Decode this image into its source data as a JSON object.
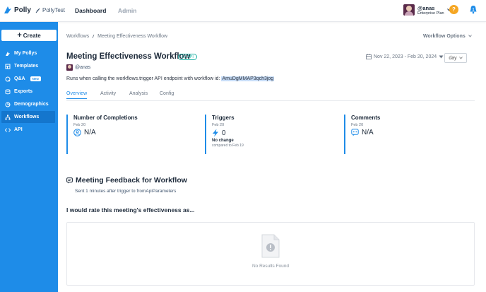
{
  "topbar": {
    "brand": "Polly",
    "workspace": "PollyTest",
    "nav": {
      "dashboard": "Dashboard",
      "admin": "Admin"
    },
    "user": {
      "name": "@anas",
      "plan": "Enterprise Plan"
    },
    "help_label": "?",
    "notification_count": "1"
  },
  "sidebar": {
    "create_label": "Create",
    "items": [
      {
        "label": "My Pollys",
        "icon": "polly-icon"
      },
      {
        "label": "Templates",
        "icon": "templates-icon"
      },
      {
        "label": "Q&A",
        "icon": "qa-icon",
        "badge": "New"
      },
      {
        "label": "Exports",
        "icon": "exports-icon"
      },
      {
        "label": "Demographics",
        "icon": "demographics-icon"
      },
      {
        "label": "Workflows",
        "icon": "workflows-icon",
        "active": true
      },
      {
        "label": "API",
        "icon": "api-icon"
      }
    ]
  },
  "breadcrumb": {
    "root": "Workflows",
    "current": "Meeting Effectiveness Workflow"
  },
  "workflow_options": "Workflow Options",
  "title": "Meeting Effectiveness Workflow",
  "api_badge": "API",
  "date_range": "Nov 22, 2023 - Feb 20, 2024",
  "granularity": "day",
  "owner": "@anas",
  "description": {
    "prefix": "Runs when calling the workflows.trigger API endpoint with workflow id: ",
    "workflow_id": "AmuDgMMAP3qch3jog"
  },
  "tabs": [
    "Overview",
    "Activity",
    "Analysis",
    "Config"
  ],
  "stats": [
    {
      "title": "Number of Completions",
      "date": "Feb 20",
      "value": "N/A"
    },
    {
      "title": "Triggers",
      "date": "Feb 20",
      "value": "0",
      "sub": "No change",
      "compare": "compared to Feb 19"
    },
    {
      "title": "Comments",
      "date": "Feb 20",
      "value": "N/A"
    }
  ],
  "feedback": {
    "title": "Meeting Feedback for Workflow",
    "subtitle": "Sent 1 minutes after trigger to fromApiParameters",
    "question": "I would rate this meeting's effectiveness as...",
    "empty_message": "No Results Found"
  },
  "colors": {
    "accent": "#1e8ce8",
    "sidebar_active": "#1476cd",
    "api_badge": "#22b3a6",
    "help": "#f5a623"
  }
}
